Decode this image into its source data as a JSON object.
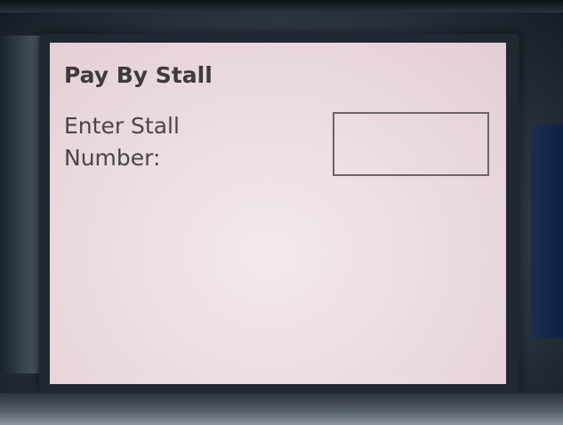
{
  "device": {
    "brand_label": "",
    "footer_url": ""
  },
  "screen": {
    "title": "Pay By Stall",
    "prompt_label": "Enter Stall Number:",
    "stall_input": {
      "value": "",
      "placeholder": ""
    },
    "colors": {
      "background": "#ecdde1",
      "text": "#3f3a3c",
      "input_border": "#6c6466"
    }
  }
}
